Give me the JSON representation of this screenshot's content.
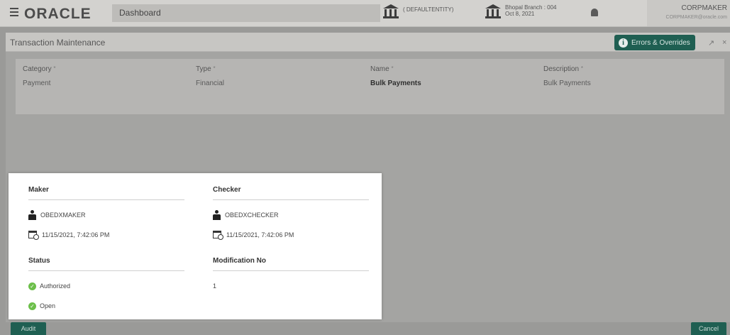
{
  "header": {
    "app_logo": "ORACLE",
    "dashboard_tab": "Dashboard",
    "entity": "( DEFAULTENTITY)",
    "branch_line1": "Bhopal Branch : 004",
    "branch_line2": "Oct 8, 2021",
    "user_name": "CORPMAKER",
    "user_email": "CORPMAKER@oracle.com"
  },
  "titlebar": {
    "title": "Transaction Maintenance",
    "errors_button": "Errors & Overrides",
    "expand_glyph": "↗",
    "close_glyph": "×"
  },
  "fields": {
    "category": {
      "label": "Category",
      "value": "Payment"
    },
    "type": {
      "label": "Type",
      "value": "Financial"
    },
    "name": {
      "label": "Name",
      "value": "Bulk Payments"
    },
    "description": {
      "label": "Description",
      "value": "Bulk Payments"
    },
    "required_mark": "*"
  },
  "audit": {
    "maker": {
      "heading": "Maker",
      "user": "OBEDXMAKER",
      "timestamp": "11/15/2021, 7:42:06 PM"
    },
    "checker": {
      "heading": "Checker",
      "user": "OBEDXCHECKER",
      "timestamp": "11/15/2021, 7:42:06 PM"
    },
    "status": {
      "heading": "Status",
      "auth_status": "Authorized",
      "record_status": "Open"
    },
    "modification": {
      "heading": "Modification No",
      "value": "1"
    }
  },
  "footer": {
    "audit_button": "Audit",
    "cancel_button": "Cancel"
  },
  "colors": {
    "accent": "#1f5f52",
    "ok_green": "#6cbf4a"
  },
  "icons": [
    "hamburger-icon",
    "bank-icon",
    "bell-icon",
    "info-icon",
    "user-icon",
    "calendar-clock-icon",
    "check-circle-icon"
  ]
}
